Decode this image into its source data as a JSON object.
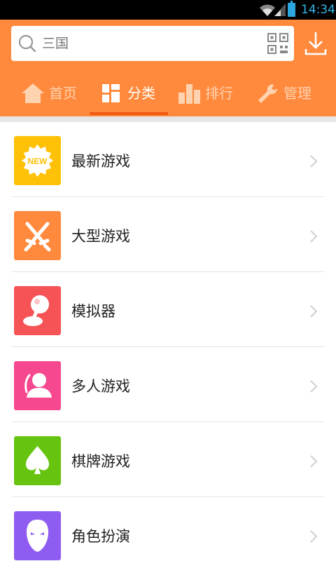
{
  "status_bar": {
    "time": "14:34"
  },
  "search": {
    "value": "三国"
  },
  "tabs": [
    {
      "label": "首页",
      "icon": "home-icon",
      "active": false
    },
    {
      "label": "分类",
      "icon": "category-grid-icon",
      "active": true
    },
    {
      "label": "排行",
      "icon": "bar-chart-icon",
      "active": false
    },
    {
      "label": "管理",
      "icon": "wrench-icon",
      "active": false
    }
  ],
  "categories": [
    {
      "label": "最新游戏",
      "icon": "new-badge-icon",
      "icon_text": "NEW",
      "color": "#ffc107"
    },
    {
      "label": "大型游戏",
      "icon": "crossed-swords-icon",
      "color": "#ff8a3d"
    },
    {
      "label": "模拟器",
      "icon": "joystick-icon",
      "color": "#f65356"
    },
    {
      "label": "多人游戏",
      "icon": "person-icon",
      "color": "#f5488f"
    },
    {
      "label": "棋牌游戏",
      "icon": "spade-icon",
      "color": "#66c411"
    },
    {
      "label": "角色扮演",
      "icon": "mask-icon",
      "color": "#8e5cf0"
    }
  ],
  "colors": {
    "header": "#ff8a3d",
    "tab_active_indicator": "#f05a14"
  }
}
